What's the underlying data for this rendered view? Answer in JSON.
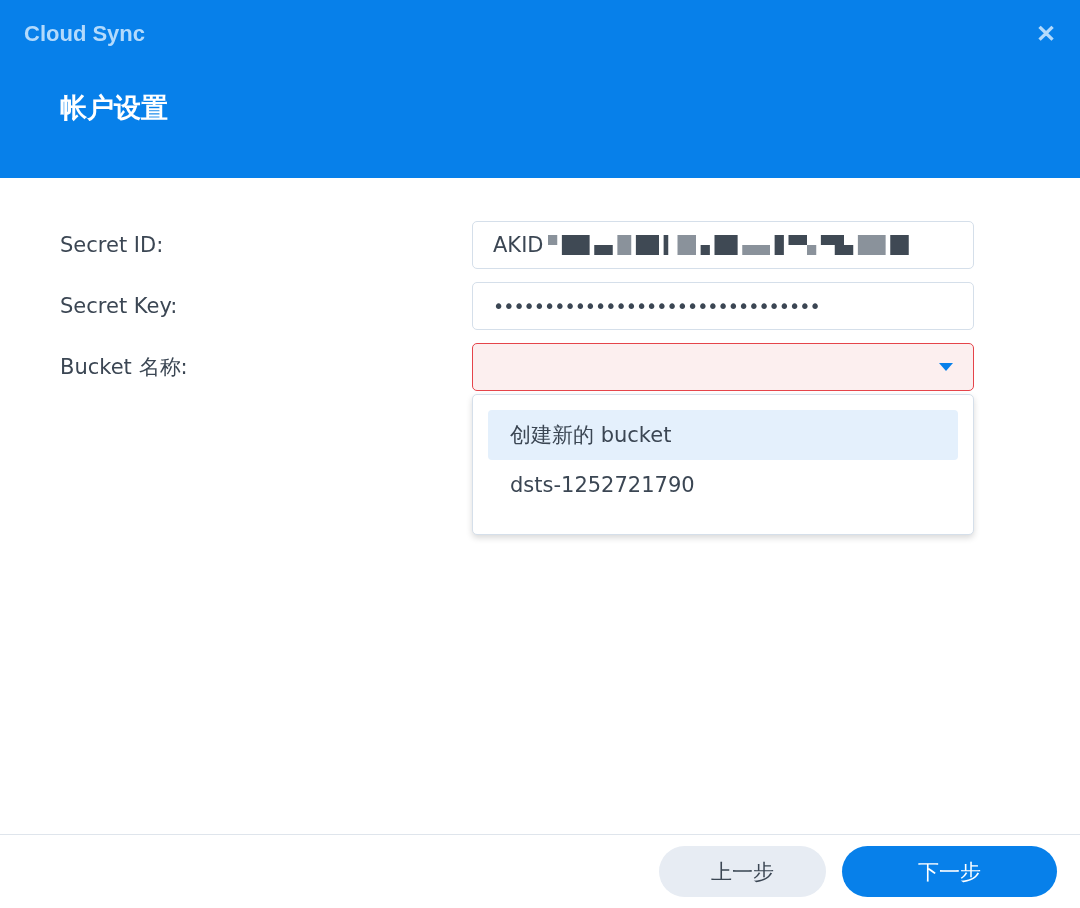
{
  "window": {
    "title": "Cloud Sync",
    "close": "✕"
  },
  "heading": "帐户设置",
  "fields": [
    {
      "kind": "text",
      "label": "Secret ID:",
      "value": "AKID",
      "redacted": true
    },
    {
      "kind": "password",
      "label": "Secret Key:",
      "value": "••••••••••••••••••••••••••••••••"
    },
    {
      "kind": "select",
      "label": "Bucket 名称:",
      "invalid": true,
      "expanded": true,
      "options": [
        {
          "label": "创建新的 bucket",
          "selected": true
        },
        {
          "label": "dsts-1252721790",
          "selected": false
        }
      ]
    }
  ],
  "buttons": [
    {
      "label": "上一步",
      "primary": false
    },
    {
      "label": "下一步",
      "primary": true
    }
  ]
}
